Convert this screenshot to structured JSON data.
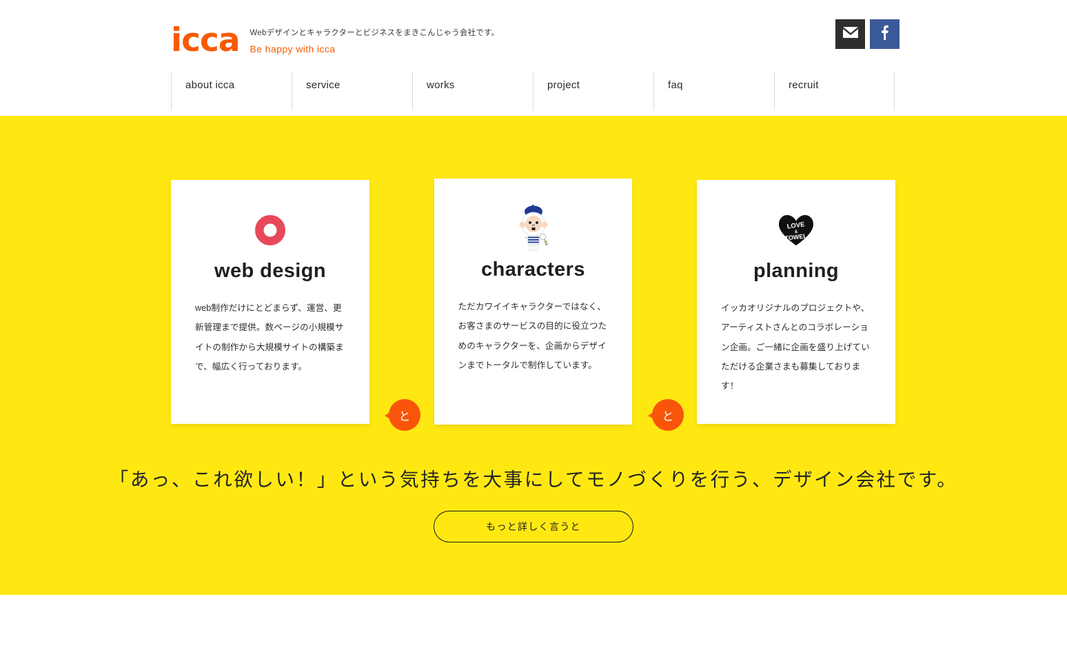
{
  "header": {
    "logo_text": "icca",
    "tagline_ja": "Webデザインとキャラクターとビジネスをまきこんじゃう会社です。",
    "tagline_en": "Be happy with icca",
    "social": [
      {
        "name": "mail",
        "label": "mail",
        "color": "#2e2e2e"
      },
      {
        "name": "facebook",
        "label": "facebook",
        "color": "#3B5998"
      }
    ]
  },
  "nav": {
    "items": [
      {
        "label": "about icca"
      },
      {
        "label": "service"
      },
      {
        "label": "works"
      },
      {
        "label": "project"
      },
      {
        "label": "faq"
      },
      {
        "label": "recruit"
      }
    ]
  },
  "main": {
    "background_color": "#FFE812",
    "cards": [
      {
        "title": "web design",
        "icon": "donut-icon",
        "body": "web制作だけにとどまらず、運営、更新管理まで提供。数ページの小規模サイトの制作から大規模サイトの構築まで、幅広く行っております。"
      },
      {
        "title": "characters",
        "icon": "mascot-character-icon",
        "body": "ただカワイイキャラクターではなく、お客さまのサービスの目的に役立つためのキャラクターを、企画からデザインまでトータルで制作しています。"
      },
      {
        "title": "planning",
        "icon": "love-and-towel-heart-icon",
        "body": "イッカオリジナルのプロジェクトや、アーティストさんとのコラボレーション企画。ご一緒に企画を盛り上げていただける企業さまも募集しております！"
      }
    ],
    "connectors": [
      {
        "label": "と"
      },
      {
        "label": "と"
      }
    ],
    "tagline": "「あっ、これ欲しい！」という気持ちを大事にしてモノづくりを行う、デザイン会社です。",
    "cta_label": "もっと詳しく言うと"
  },
  "colors": {
    "brand_orange": "#F85A00",
    "accent_orange": "#F9550A",
    "yellow": "#FFE812",
    "facebook_blue": "#3B5998",
    "mail_dark": "#2e2e2e",
    "donut_red": "#E8495A"
  }
}
